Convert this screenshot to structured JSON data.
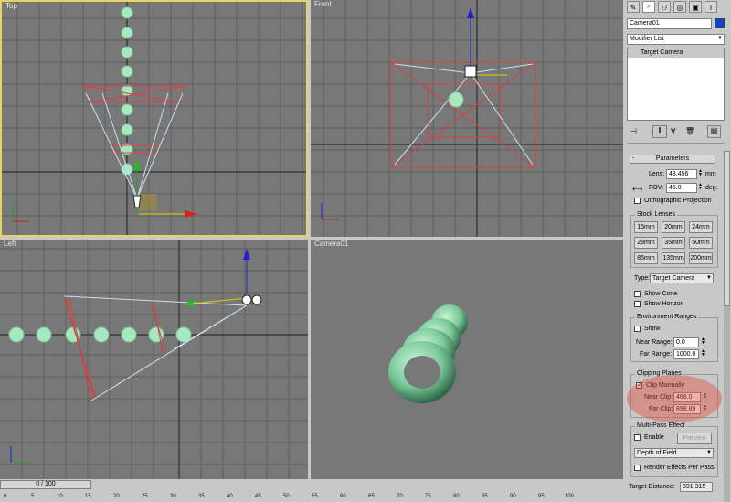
{
  "viewports": {
    "top": "Top",
    "front": "Front",
    "left": "Left",
    "camera": "Camera01"
  },
  "command_panel": {
    "toolbar_icons": [
      "create-icon",
      "modify-icon",
      "hierarchy-icon",
      "motion-icon",
      "display-icon",
      "utilities-icon"
    ],
    "object_name": "Camera01",
    "object_color": "#1040d0",
    "modifier_list": "Modifier List",
    "stack_item": "Target Camera",
    "rollout_title": "Parameters",
    "lens_label": "Lens:",
    "lens_value": "43.456",
    "lens_unit": "mm",
    "fov_label": "FOV:",
    "fov_value": "45.0",
    "fov_unit": "deg.",
    "ortho_label": "Orthographic Projection",
    "stock_lenses_title": "Stock Lenses",
    "stock_lenses": [
      "15mm",
      "20mm",
      "24mm",
      "28mm",
      "35mm",
      "50mm",
      "85mm",
      "135mm",
      "200mm"
    ],
    "type_label": "Type:",
    "type_value": "Target Camera",
    "show_cone": "Show Cone",
    "show_horizon": "Show Horizon",
    "env_title": "Environment Ranges",
    "env_show": "Show",
    "near_range_label": "Near Range:",
    "near_range_value": "0.0",
    "far_range_label": "Far Range:",
    "far_range_value": "1000.0",
    "clip_title": "Clipping Planes",
    "clip_manually": "Clip Manually",
    "near_clip_label": "Near Clip:",
    "near_clip_value": "468.0",
    "far_clip_label": "Far Clip:",
    "far_clip_value": "898.89",
    "multipass_title": "Multi-Pass Effect",
    "enable_label": "Enable",
    "preview_label": "Preview",
    "effect_value": "Depth of Field",
    "render_effects": "Render Effects Per Pass",
    "target_distance_label": "Target Distance:",
    "target_distance_value": "591.315"
  },
  "timeline": {
    "slider": "0 / 100",
    "ticks": [
      "0",
      "5",
      "10",
      "15",
      "20",
      "25",
      "30",
      "35",
      "40",
      "45",
      "50",
      "55",
      "60",
      "65",
      "70",
      "75",
      "80",
      "85",
      "90",
      "95",
      "100"
    ]
  },
  "colors": {
    "viewport_bg": "#787878",
    "active_border": "#e6d36a",
    "highlight": "#e05040"
  }
}
